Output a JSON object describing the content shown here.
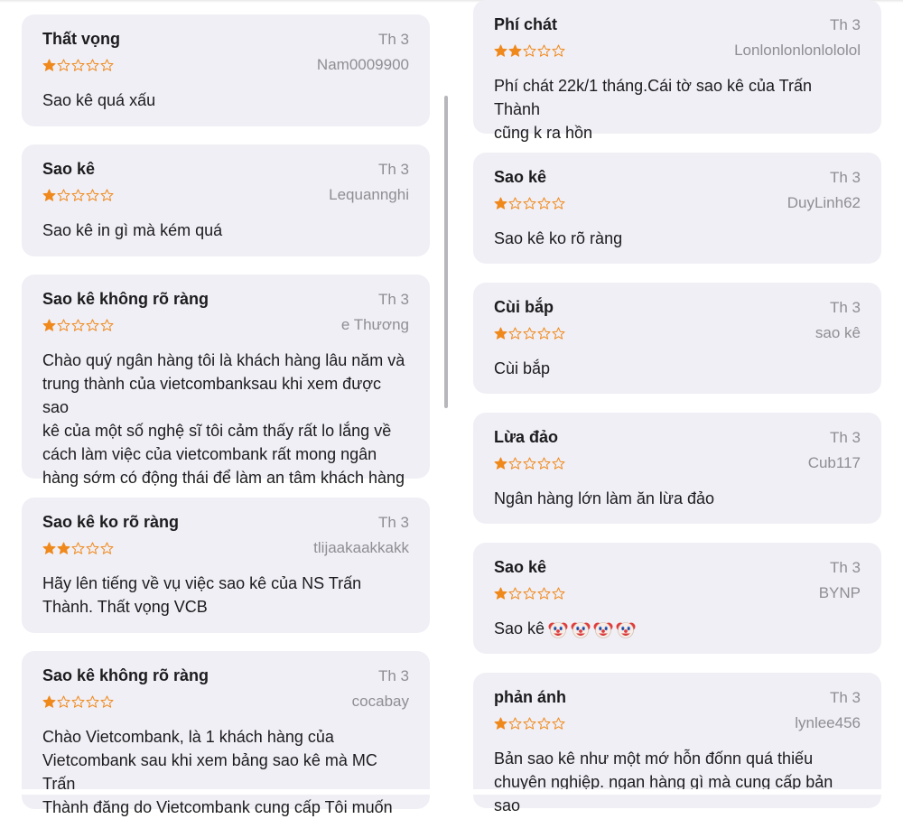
{
  "colors": {
    "card_bg": "#f0eff5",
    "star_filled": "#f0891c",
    "star_empty_outline": "#f0891c",
    "meta_gray": "#8e8e93",
    "text": "#1c1c1e"
  },
  "left_reviews": [
    {
      "title": "Thất vọng",
      "date": "Th 3",
      "author": "Nam0009900",
      "rating": 1,
      "body": "Sao kê quá xấu"
    },
    {
      "title": "Sao kê",
      "date": "Th 3",
      "author": "Lequannghi",
      "rating": 1,
      "body": "Sao kê in gì mà kém quá"
    },
    {
      "title": "Sao kê không rõ ràng",
      "date": "Th 3",
      "author": "e Thương",
      "rating": 1,
      "body": "Chào quý ngân hàng tôi là khách hàng lâu năm và\ntrung thành của vietcombanksau khi xem được sao\nkê của một số nghệ sĩ tôi cảm thấy rất lo lắng về\ncách làm việc của vietcombank rất mong ngân\nhàng sớm có động thái để làm an tâm khách hàng"
    },
    {
      "title": "Sao kê ko rõ ràng",
      "date": "Th 3",
      "author": "tlijaakaakkakk",
      "rating": 2,
      "body": "Hãy lên tiếng về vụ việc sao kê của NS Trấn\nThành. Thất vọng VCB"
    },
    {
      "title": "Sao kê không rõ ràng",
      "date": "Th 3",
      "author": "cocabay",
      "rating": 1,
      "body": "Chào Vietcombank, là 1 khách hàng của\nVietcombank sau khi xem bảng sao kê mà MC Trấn\nThành  đăng do Vietcombank cung cấp Tôi muốn"
    }
  ],
  "right_reviews": [
    {
      "title": "Phí chát",
      "date": "Th 3",
      "author": "Lonlonlonlonlololol",
      "rating": 2,
      "body": "Phí chát 22k/1 tháng.Cái tờ sao kê của Trấn Thành\ncũng k ra hồn"
    },
    {
      "title": "Sao kê",
      "date": "Th 3",
      "author": "DuyLinh62",
      "rating": 1,
      "body": "Sao kê ko rõ ràng"
    },
    {
      "title": "Cùi bắp",
      "date": "Th 3",
      "author": "sao kê",
      "rating": 1,
      "body": "Cùi bắp"
    },
    {
      "title": "Lừa đảo",
      "date": "Th 3",
      "author": "Cub117",
      "rating": 1,
      "body": "Ngân hàng lớn làm ăn lừa đảo"
    },
    {
      "title": "Sao kê",
      "date": "Th 3",
      "author": "BYNP",
      "rating": 1,
      "body": "Sao kê",
      "emoji": [
        "clown-face-icon",
        "clown-face-icon",
        "clown-face-icon",
        "clown-face-icon"
      ]
    },
    {
      "title": "phản ánh",
      "date": "Th 3",
      "author": "lynlee456",
      "rating": 1,
      "body": "Bản sao kê như một mớ hỗn đốnn quá thiếu\nchuyên nghiệp. ngan hàng gì mà cung cấp bản sao"
    }
  ]
}
